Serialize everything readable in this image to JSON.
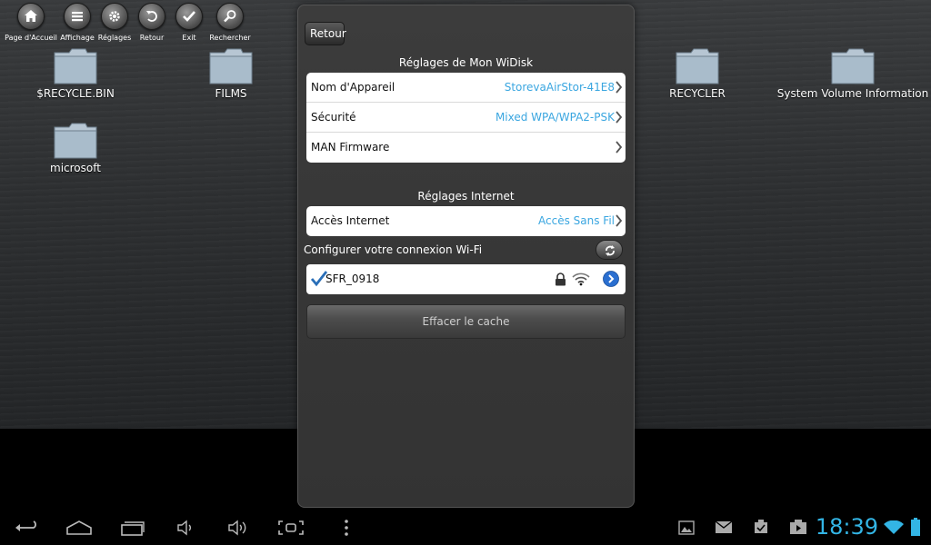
{
  "toolbar": [
    {
      "label": "Page d'Accueil",
      "icon": "home-icon"
    },
    {
      "label": "Affichage",
      "icon": "list-icon"
    },
    {
      "label": "Réglages",
      "icon": "gear-icon"
    },
    {
      "label": "Retour",
      "icon": "undo-icon"
    },
    {
      "label": "Exit",
      "icon": "check-icon"
    },
    {
      "label": "Rechercher",
      "icon": "search-icon"
    }
  ],
  "folders": [
    {
      "name": "$RECYCLE.BIN"
    },
    {
      "name": "FILMS"
    },
    {
      "name": "RECYCLER"
    },
    {
      "name": "System Volume Information"
    },
    {
      "name": "microsoft"
    }
  ],
  "panel": {
    "back_label": "Retour",
    "section1_title": "Réglages de Mon WiDisk",
    "device_rows": [
      {
        "label": "Nom d'Appareil",
        "value": "StorevaAirStor-41E8"
      },
      {
        "label": "Sécurité",
        "value": "Mixed WPA/WPA2-PSK"
      },
      {
        "label": "MAN Firmware",
        "value": ""
      }
    ],
    "section2_title": "Réglages Internet",
    "internet_row": {
      "label": "Accès Internet",
      "value": "Accès Sans Fil"
    },
    "wifi_header": "Configurer votre connexion Wi-Fi",
    "wifi_network": {
      "ssid": "SFR_0918",
      "selected": true,
      "locked": true
    },
    "clear_cache_label": "Effacer le cache"
  },
  "statusbar": {
    "time": "18:39",
    "accent": "#33b5e5"
  }
}
